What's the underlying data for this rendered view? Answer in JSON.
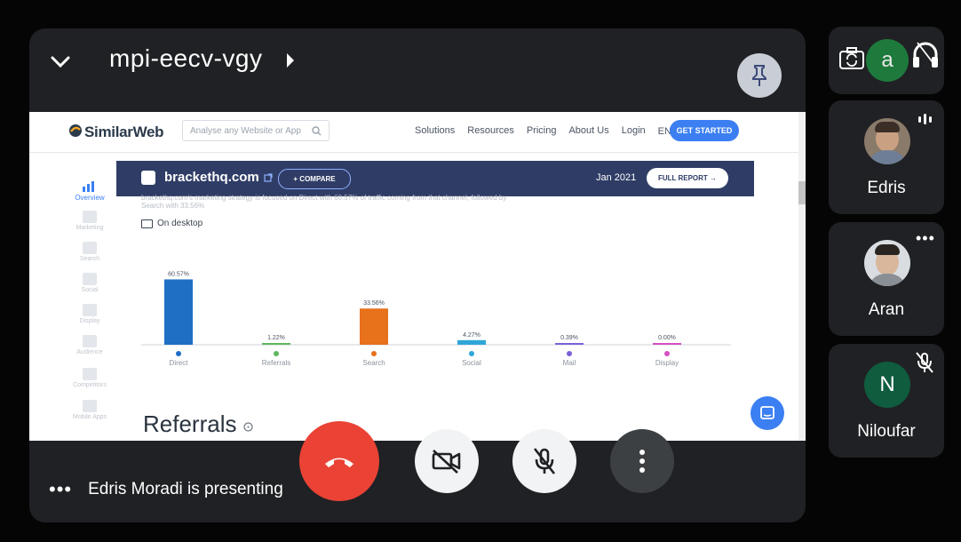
{
  "meeting": {
    "code": "mpi-eecv-vgy"
  },
  "presenter": {
    "status": "Edris Moradi is presenting"
  },
  "shared_screen": {
    "nav": {
      "logo": "SimilarWeb",
      "search_placeholder": "Analyse any Website or App",
      "links": [
        "Solutions",
        "Resources",
        "Pricing",
        "About Us",
        "Login",
        "EN ▾"
      ],
      "cta": "GET STARTED"
    },
    "sidebar": [
      "Overview",
      "Marketing",
      "Search",
      "Social",
      "Display",
      "Audience",
      "Competitors",
      "Mobile Apps"
    ],
    "header": {
      "domain": "brackethq.com",
      "compare": "+ COMPARE",
      "date": "Jan 2021",
      "report": "FULL REPORT →"
    },
    "faded_text": "brackethq.com's marketing strategy is focused on Direct with 60.57% of traffic coming from that channel, followed by Search with 33.56%",
    "device": "On desktop",
    "section_title": "Referrals"
  },
  "chart_data": {
    "type": "bar",
    "categories": [
      "Direct",
      "Referrals",
      "Search",
      "Social",
      "Mail",
      "Display"
    ],
    "values": [
      60.57,
      1.22,
      33.56,
      4.27,
      0.39,
      0.0
    ],
    "value_labels": [
      "60.57%",
      "1.22%",
      "33.56%",
      "4.27%",
      "0.39%",
      "0.00%"
    ],
    "colors": [
      "#1f6fc5",
      "#5cb85c",
      "#e8711c",
      "#2fa6d8",
      "#7b61d8",
      "#d64fc2"
    ],
    "ylim": [
      0,
      70
    ],
    "grid": false
  },
  "participants": [
    {
      "name": "a",
      "status": "self"
    },
    {
      "name": "Edris",
      "status": "speaking"
    },
    {
      "name": "Aran",
      "status": "options"
    },
    {
      "name": "Niloufar",
      "initial": "N",
      "status": "muted"
    }
  ],
  "colors": {
    "end_call": "#ea4335",
    "surface": "#202124",
    "niloufar_avatar": "#0f5c3f",
    "self_avatar": "#1e7a3c"
  }
}
